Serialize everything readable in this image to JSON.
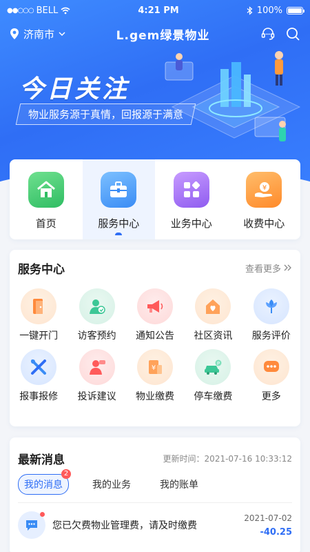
{
  "status_bar": {
    "carrier": "BELL",
    "time": "4:21 PM",
    "battery": "100%",
    "battery_level": 1.0
  },
  "navbar": {
    "city": "济南市",
    "logo": "L.gem绿景物业",
    "icons": [
      "location-pin-icon",
      "chevron-down-icon",
      "customer-service-icon",
      "search-icon"
    ]
  },
  "hero": {
    "title": "今日关注",
    "subtitle": "物业服务源于真情，回报源于满意"
  },
  "quick_nav": {
    "items": [
      {
        "label": "首页",
        "icon": "home-icon"
      },
      {
        "label": "服务中心",
        "icon": "briefcase-icon",
        "active": true
      },
      {
        "label": "业务中心",
        "icon": "grid-apps-icon"
      },
      {
        "label": "收费中心",
        "icon": "yen-hand-icon"
      }
    ]
  },
  "service_center": {
    "title": "服务中心",
    "more": "查看更多",
    "items": [
      {
        "label": "一键开门",
        "icon": "door-icon"
      },
      {
        "label": "访客预约",
        "icon": "visitor-icon"
      },
      {
        "label": "通知公告",
        "icon": "megaphone-icon"
      },
      {
        "label": "社区资讯",
        "icon": "community-heart-icon"
      },
      {
        "label": "服务评价",
        "icon": "flower-icon"
      },
      {
        "label": "报事报修",
        "icon": "tools-icon"
      },
      {
        "label": "投诉建议",
        "icon": "complaint-icon"
      },
      {
        "label": "物业缴费",
        "icon": "property-bill-icon"
      },
      {
        "label": "停车缴费",
        "icon": "car-icon"
      },
      {
        "label": "更多",
        "icon": "more-dots-icon"
      }
    ]
  },
  "messages": {
    "title": "最新消息",
    "update_time": "更新时间：2021-07-16  10:33:12",
    "tabs": [
      {
        "label": "我的消息",
        "badge": "2",
        "active": true
      },
      {
        "label": "我的业务"
      },
      {
        "label": "我的账单"
      }
    ],
    "items": [
      {
        "text": "您已欠费物业管理费，请及时缴费",
        "date": "2021-07-02",
        "amount": "-40.25"
      }
    ]
  },
  "colors": {
    "primary": "#2f6ef5",
    "hero_start": "#3f8cff",
    "alert": "#ff5a5a"
  }
}
